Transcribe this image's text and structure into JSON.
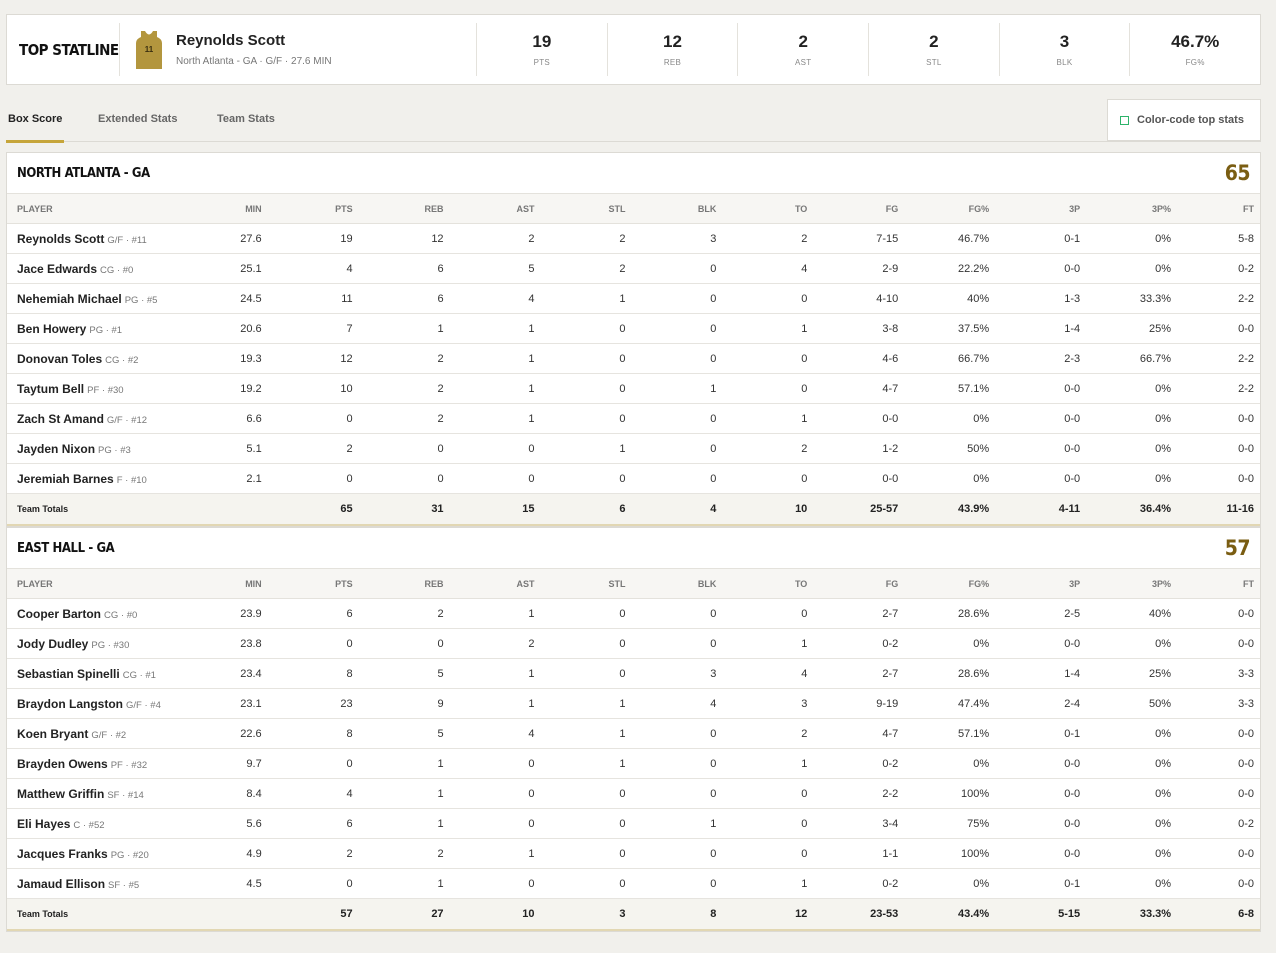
{
  "top_statline": {
    "label": "TOP STATLINE",
    "jersey_number": "11",
    "player_name": "Reynolds Scott",
    "player_sub": "North Atlanta - GA · G/F · 27.6 MIN",
    "stats": [
      {
        "value": "19",
        "label": "PTS"
      },
      {
        "value": "12",
        "label": "REB"
      },
      {
        "value": "2",
        "label": "AST"
      },
      {
        "value": "2",
        "label": "STL"
      },
      {
        "value": "3",
        "label": "BLK"
      },
      {
        "value": "46.7%",
        "label": "FG%"
      }
    ]
  },
  "tabs": [
    "Box Score",
    "Extended Stats",
    "Team Stats"
  ],
  "color_code_label": "Color-code top stats",
  "columns": [
    "PLAYER",
    "MIN",
    "PTS",
    "REB",
    "AST",
    "STL",
    "BLK",
    "TO",
    "FG",
    "FG%",
    "3P",
    "3P%",
    "FT"
  ],
  "teams": [
    {
      "name": "NORTH ATLANTA - GA",
      "score": "65",
      "players": [
        {
          "name": "Reynolds Scott",
          "meta": "G/F · #11",
          "stats": [
            "27.6",
            "19",
            "12",
            "2",
            "2",
            "3",
            "2",
            "7-15",
            "46.7%",
            "0-1",
            "0%",
            "5-8"
          ]
        },
        {
          "name": "Jace Edwards",
          "meta": "CG · #0",
          "stats": [
            "25.1",
            "4",
            "6",
            "5",
            "2",
            "0",
            "4",
            "2-9",
            "22.2%",
            "0-0",
            "0%",
            "0-2"
          ]
        },
        {
          "name": "Nehemiah Michael",
          "meta": "PG · #5",
          "stats": [
            "24.5",
            "11",
            "6",
            "4",
            "1",
            "0",
            "0",
            "4-10",
            "40%",
            "1-3",
            "33.3%",
            "2-2"
          ]
        },
        {
          "name": "Ben Howery",
          "meta": "PG · #1",
          "stats": [
            "20.6",
            "7",
            "1",
            "1",
            "0",
            "0",
            "1",
            "3-8",
            "37.5%",
            "1-4",
            "25%",
            "0-0"
          ]
        },
        {
          "name": "Donovan Toles",
          "meta": "CG · #2",
          "stats": [
            "19.3",
            "12",
            "2",
            "1",
            "0",
            "0",
            "0",
            "4-6",
            "66.7%",
            "2-3",
            "66.7%",
            "2-2"
          ]
        },
        {
          "name": "Taytum Bell",
          "meta": "PF · #30",
          "stats": [
            "19.2",
            "10",
            "2",
            "1",
            "0",
            "1",
            "0",
            "4-7",
            "57.1%",
            "0-0",
            "0%",
            "2-2"
          ]
        },
        {
          "name": "Zach St Amand",
          "meta": "G/F · #12",
          "stats": [
            "6.6",
            "0",
            "2",
            "1",
            "0",
            "0",
            "1",
            "0-0",
            "0%",
            "0-0",
            "0%",
            "0-0"
          ]
        },
        {
          "name": "Jayden Nixon",
          "meta": "PG · #3",
          "stats": [
            "5.1",
            "2",
            "0",
            "0",
            "1",
            "0",
            "2",
            "1-2",
            "50%",
            "0-0",
            "0%",
            "0-0"
          ]
        },
        {
          "name": "Jeremiah Barnes",
          "meta": "F · #10",
          "stats": [
            "2.1",
            "0",
            "0",
            "0",
            "0",
            "0",
            "0",
            "0-0",
            "0%",
            "0-0",
            "0%",
            "0-0"
          ]
        }
      ],
      "totals": {
        "label": "Team Totals",
        "stats": [
          "",
          "65",
          "31",
          "15",
          "6",
          "4",
          "10",
          "25-57",
          "43.9%",
          "4-11",
          "36.4%",
          "11-16"
        ]
      }
    },
    {
      "name": "EAST HALL - GA",
      "score": "57",
      "players": [
        {
          "name": "Cooper Barton",
          "meta": "CG · #0",
          "stats": [
            "23.9",
            "6",
            "2",
            "1",
            "0",
            "0",
            "0",
            "2-7",
            "28.6%",
            "2-5",
            "40%",
            "0-0"
          ]
        },
        {
          "name": "Jody Dudley",
          "meta": "PG · #30",
          "stats": [
            "23.8",
            "0",
            "0",
            "2",
            "0",
            "0",
            "1",
            "0-2",
            "0%",
            "0-0",
            "0%",
            "0-0"
          ]
        },
        {
          "name": "Sebastian Spinelli",
          "meta": "CG · #1",
          "stats": [
            "23.4",
            "8",
            "5",
            "1",
            "0",
            "3",
            "4",
            "2-7",
            "28.6%",
            "1-4",
            "25%",
            "3-3"
          ]
        },
        {
          "name": "Braydon Langston",
          "meta": "G/F · #4",
          "stats": [
            "23.1",
            "23",
            "9",
            "1",
            "1",
            "4",
            "3",
            "9-19",
            "47.4%",
            "2-4",
            "50%",
            "3-3"
          ]
        },
        {
          "name": "Koen Bryant",
          "meta": "G/F · #2",
          "stats": [
            "22.6",
            "8",
            "5",
            "4",
            "1",
            "0",
            "2",
            "4-7",
            "57.1%",
            "0-1",
            "0%",
            "0-0"
          ]
        },
        {
          "name": "Brayden Owens",
          "meta": "PF · #32",
          "stats": [
            "9.7",
            "0",
            "1",
            "0",
            "1",
            "0",
            "1",
            "0-2",
            "0%",
            "0-0",
            "0%",
            "0-0"
          ]
        },
        {
          "name": "Matthew Griffin",
          "meta": "SF · #14",
          "stats": [
            "8.4",
            "4",
            "1",
            "0",
            "0",
            "0",
            "0",
            "2-2",
            "100%",
            "0-0",
            "0%",
            "0-0"
          ]
        },
        {
          "name": "Eli Hayes",
          "meta": "C · #52",
          "stats": [
            "5.6",
            "6",
            "1",
            "0",
            "0",
            "1",
            "0",
            "3-4",
            "75%",
            "0-0",
            "0%",
            "0-2"
          ]
        },
        {
          "name": "Jacques Franks",
          "meta": "PG · #20",
          "stats": [
            "4.9",
            "2",
            "2",
            "1",
            "0",
            "0",
            "0",
            "1-1",
            "100%",
            "0-0",
            "0%",
            "0-0"
          ]
        },
        {
          "name": "Jamaud Ellison",
          "meta": "SF · #5",
          "stats": [
            "4.5",
            "0",
            "1",
            "0",
            "0",
            "0",
            "1",
            "0-2",
            "0%",
            "0-1",
            "0%",
            "0-0"
          ]
        }
      ],
      "totals": {
        "label": "Team Totals",
        "stats": [
          "",
          "57",
          "27",
          "10",
          "3",
          "8",
          "12",
          "23-53",
          "43.4%",
          "5-15",
          "33.3%",
          "6-8"
        ]
      }
    }
  ],
  "colors": {
    "accent": "#c6a53a",
    "score": "#7a5d12",
    "jersey": "#b3963e"
  }
}
